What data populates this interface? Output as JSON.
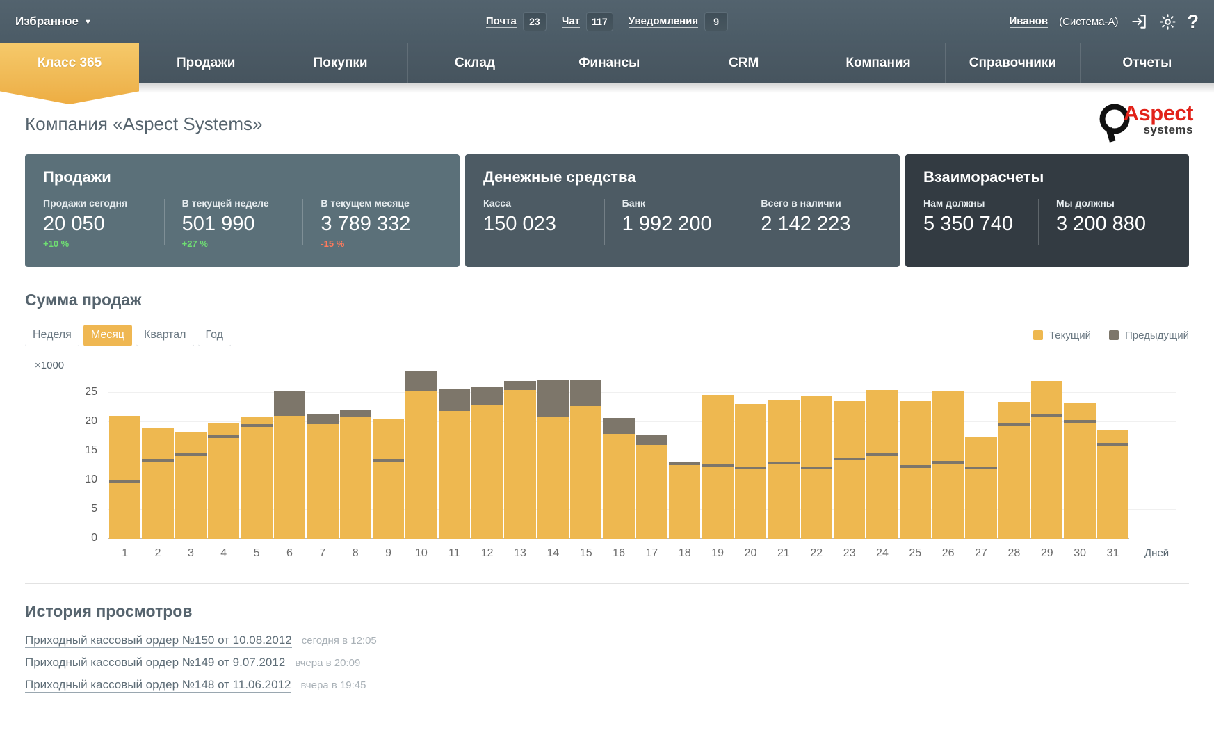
{
  "topbar": {
    "favorites_label": "Избранное",
    "caret_glyph": "▼",
    "items": [
      {
        "label": "Почта",
        "count": "23"
      },
      {
        "label": "Чат",
        "count": "117"
      },
      {
        "label": "Уведомления",
        "count": "9"
      }
    ],
    "user_name": "Иванов",
    "user_system": "(Система-А)",
    "icons": [
      "logout-icon",
      "gear-icon",
      "help-icon"
    ],
    "help_glyph": "?"
  },
  "nav": {
    "tabs": [
      {
        "label": "Класс 365",
        "active": true
      },
      {
        "label": "Продажи",
        "active": false
      },
      {
        "label": "Покупки",
        "active": false
      },
      {
        "label": "Склад",
        "active": false
      },
      {
        "label": "Финансы",
        "active": false
      },
      {
        "label": "CRM",
        "active": false
      },
      {
        "label": "Компания",
        "active": false
      },
      {
        "label": "Справочники",
        "active": false
      },
      {
        "label": "Отчеты",
        "active": false
      }
    ]
  },
  "page": {
    "title": "Компания «Aspect Systems»",
    "logo": {
      "word1": "Aspect",
      "word2": "systems"
    }
  },
  "cards": [
    {
      "id": "sales",
      "title": "Продажи",
      "metrics": [
        {
          "label": "Продажи сегодня",
          "value": "20 050",
          "delta": "+10 %",
          "dir": "up"
        },
        {
          "label": "В текущей неделе",
          "value": "501 990",
          "delta": "+27 %",
          "dir": "up"
        },
        {
          "label": "В текущем месяце",
          "value": "3 789 332",
          "delta": "-15 %",
          "dir": "down"
        }
      ]
    },
    {
      "id": "cash",
      "title": "Денежные средства",
      "metrics": [
        {
          "label": "Касса",
          "value": "150 023",
          "delta": "",
          "dir": "none"
        },
        {
          "label": "Банк",
          "value": "1 992 200",
          "delta": "",
          "dir": "none"
        },
        {
          "label": "Всего в наличии",
          "value": "2 142 223",
          "delta": "",
          "dir": "none"
        }
      ]
    },
    {
      "id": "mutual",
      "title": "Взаиморасчеты",
      "metrics": [
        {
          "label": "Нам должны",
          "value": "5 350 740",
          "delta": "",
          "dir": "none"
        },
        {
          "label": "Мы должны",
          "value": "3 200 880",
          "delta": "",
          "dir": "none"
        }
      ]
    }
  ],
  "chart_section": {
    "title": "Сумма продаж",
    "range_tabs": [
      {
        "label": "Неделя",
        "active": false
      },
      {
        "label": "Месяц",
        "active": true
      },
      {
        "label": "Квартал",
        "active": false
      },
      {
        "label": "Год",
        "active": false
      }
    ]
  },
  "chart_data": {
    "type": "bar",
    "title": "Сумма продаж",
    "xlabel": "Дней",
    "ylabel": "×1000",
    "y_unit_label": "×1000",
    "x_unit_label": "Дней",
    "ylim": [
      0,
      27.5
    ],
    "yticks": [
      0,
      5,
      10,
      15,
      20,
      25
    ],
    "ytick_labels": [
      "0",
      "5",
      "10",
      "15",
      "20",
      "25"
    ],
    "grid": true,
    "legend_position": "top-right",
    "categories": [
      "1",
      "2",
      "3",
      "4",
      "5",
      "6",
      "7",
      "8",
      "9",
      "10",
      "11",
      "12",
      "13",
      "14",
      "15",
      "16",
      "17",
      "18",
      "19",
      "20",
      "21",
      "22",
      "23",
      "24",
      "25",
      "26",
      "27",
      "28",
      "29",
      "30",
      "31"
    ],
    "series": [
      {
        "name": "Текущий",
        "color": "#eeb850",
        "values": [
          21.0,
          18.9,
          18.2,
          19.7,
          20.9,
          21.0,
          19.6,
          20.8,
          20.4,
          25.3,
          21.9,
          22.9,
          25.4,
          20.9,
          22.7,
          18.0,
          16.0,
          13.0,
          24.6,
          23.1,
          23.8,
          24.4,
          23.7,
          25.4,
          23.6,
          25.2,
          17.4,
          23.4,
          27.0,
          23.2,
          18.6
        ]
      },
      {
        "name": "Предыдущий",
        "color": "#7d766a",
        "values": [
          9.8,
          13.5,
          14.4,
          17.5,
          19.4,
          25.2,
          21.4,
          22.1,
          13.4,
          28.7,
          25.6,
          25.9,
          27.0,
          27.1,
          27.2,
          20.7,
          17.7,
          12.8,
          12.5,
          12.1,
          13.0,
          12.2,
          13.7,
          14.4,
          12.4,
          13.1,
          12.2,
          19.5,
          21.2,
          20.1,
          16.2
        ]
      }
    ]
  },
  "history": {
    "title": "История просмотров",
    "rows": [
      {
        "link": "Приходный кассовый ордер №150 от 10.08.2012",
        "time": "сегодня в 12:05"
      },
      {
        "link": "Приходный кассовый ордер №149 от 9.07.2012",
        "time": "вчера в 20:09"
      },
      {
        "link": "Приходный кассовый ордер №148 от 11.06.2012",
        "time": "вчера в 19:45"
      }
    ]
  },
  "colors": {
    "accent": "#efb752",
    "current_series": "#eeb850",
    "previous_series": "#7d766a",
    "header_bg": "#4c5b66",
    "card_sales": "#5b7079",
    "card_cash": "#4d5b64",
    "card_mutual": "#333b42",
    "positive": "#6fdf72",
    "negative": "#ff7a5c",
    "brand_red": "#e2231a"
  }
}
